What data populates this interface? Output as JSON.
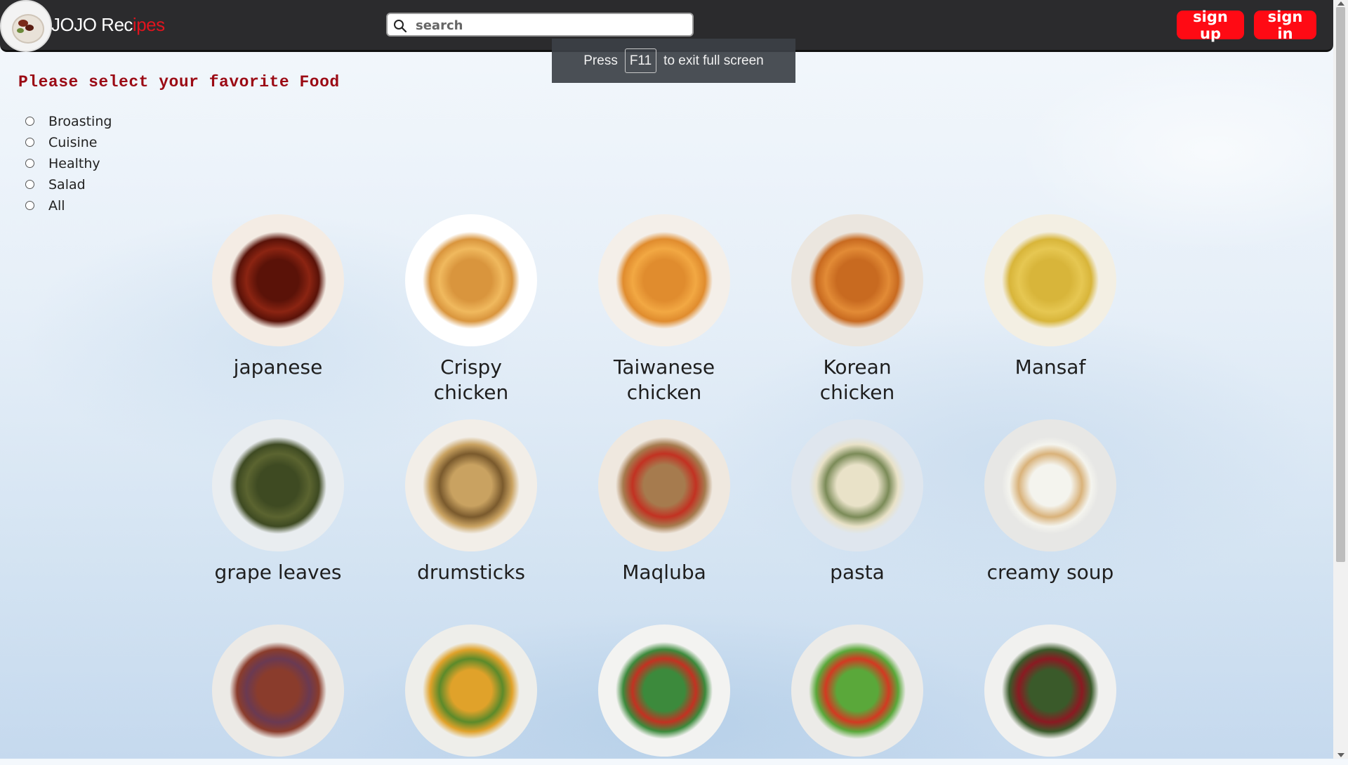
{
  "brand": {
    "prefix": "JOJO Rec",
    "suffix": "ipes"
  },
  "search": {
    "placeholder": "search"
  },
  "nav": {
    "signup_label": "sign up",
    "signin_label": "sign in"
  },
  "fullscreen_toast": {
    "before": "Press",
    "key": "F11",
    "after": "to exit full screen"
  },
  "filter": {
    "heading": "Please select your favorite Food",
    "options": [
      "Broasting",
      "Cuisine",
      "Healthy",
      "Salad",
      "All"
    ]
  },
  "foods": [
    {
      "name": "japanese",
      "palette": [
        "#5a1208",
        "#8b2412",
        "#f4ece4"
      ]
    },
    {
      "name": "Crispy chicken",
      "palette": [
        "#d9953d",
        "#f0b95e",
        "#ffffff"
      ]
    },
    {
      "name": "Taiwanese chicken",
      "palette": [
        "#e08c2e",
        "#f2a843",
        "#f4efe9"
      ]
    },
    {
      "name": "Korean chicken",
      "palette": [
        "#c86a20",
        "#e28b36",
        "#ebe6df"
      ]
    },
    {
      "name": "Mansaf",
      "palette": [
        "#d8b53a",
        "#e6c752",
        "#f3efe3"
      ]
    },
    {
      "name": "grape leaves",
      "palette": [
        "#3e4a22",
        "#5b6430",
        "#e9edf0"
      ]
    },
    {
      "name": "drumsticks",
      "palette": [
        "#c9a261",
        "#7a5a2d",
        "#f2eee8"
      ]
    },
    {
      "name": "Maqluba",
      "palette": [
        "#a67b4e",
        "#c23222",
        "#efe8df"
      ]
    },
    {
      "name": "pasta",
      "palette": [
        "#e9e2c8",
        "#7b8b58",
        "#dfe6ee"
      ]
    },
    {
      "name": "creamy soup",
      "palette": [
        "#f4f4ee",
        "#d9b27a",
        "#e7e7e5"
      ]
    },
    {
      "name": "",
      "palette": [
        "#8a3c2c",
        "#6a3a52",
        "#eceae6"
      ]
    },
    {
      "name": "",
      "palette": [
        "#e0a22a",
        "#5c8a2a",
        "#eeeeea"
      ]
    },
    {
      "name": "",
      "palette": [
        "#3c8a3c",
        "#c23222",
        "#f3f3f1"
      ]
    },
    {
      "name": "",
      "palette": [
        "#5aa83a",
        "#d23a22",
        "#ecebe8"
      ]
    },
    {
      "name": "",
      "palette": [
        "#3a5a2a",
        "#8a1a22",
        "#f1f1ef"
      ]
    }
  ]
}
